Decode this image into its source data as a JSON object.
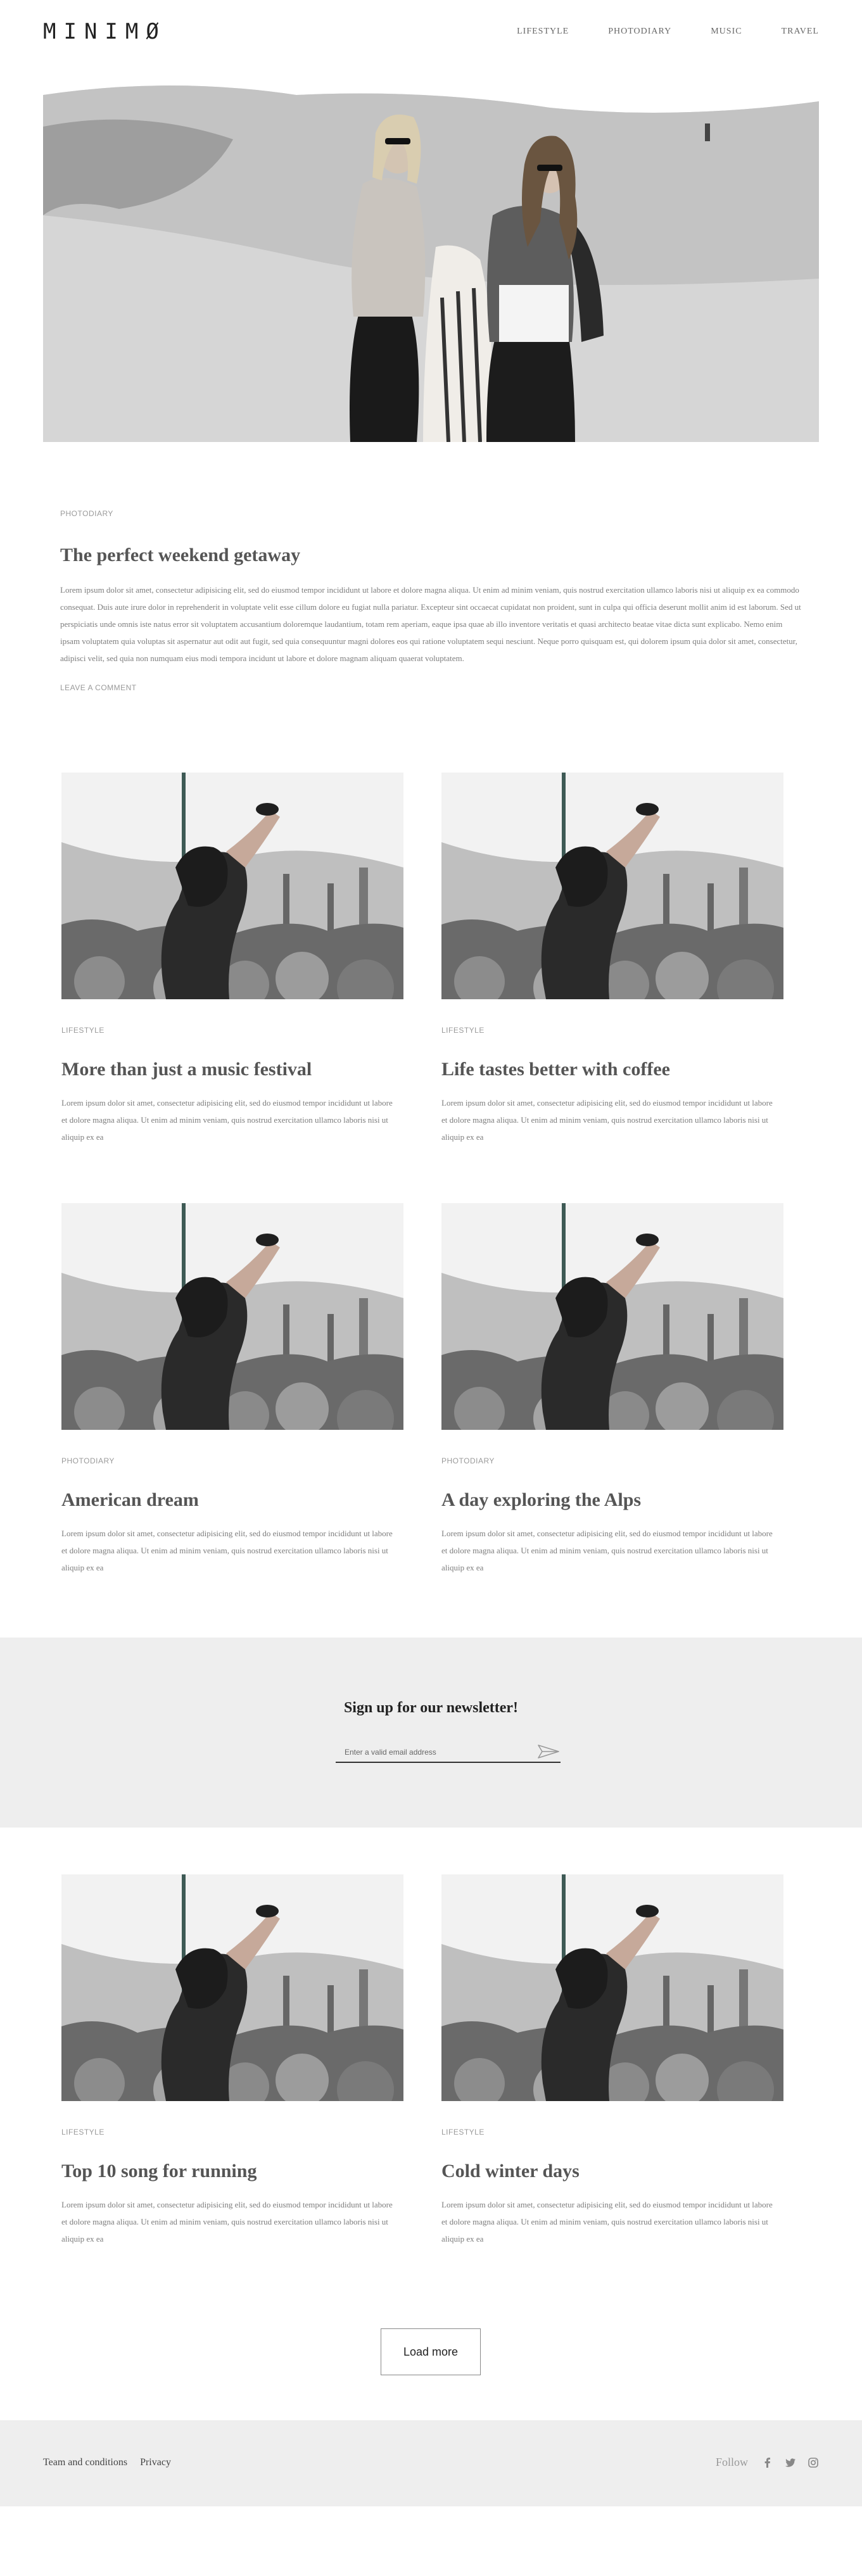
{
  "header": {
    "logo": "MINIMØ",
    "nav": [
      "LIFESTYLE",
      "PHOTODIARY",
      "MUSIC",
      "TRAVEL"
    ]
  },
  "featured": {
    "category": "PHOTODIARY",
    "title": "The perfect weekend getaway",
    "body": "Lorem ipsum dolor sit amet, consectetur adipisicing elit, sed do eiusmod tempor incididunt ut labore et dolore magna aliqua. Ut enim ad minim veniam, quis nostrud exercitation ullamco laboris nisi ut aliquip ex ea commodo consequat. Duis aute irure dolor in reprehenderit in voluptate velit esse cillum dolore eu fugiat nulla pariatur. Excepteur sint occaecat cupidatat non proident, sunt in culpa qui officia deserunt mollit anim id est laborum. Sed ut perspiciatis unde omnis iste natus error sit voluptatem accusantium doloremque laudantium, totam rem aperiam, eaque ipsa quae ab illo inventore veritatis et quasi architecto beatae vitae dicta sunt explicabo. Nemo enim ipsam voluptatem quia voluptas sit aspernatur aut odit aut fugit, sed quia consequuntur magni dolores eos qui ratione voluptatem sequi nesciunt. Neque porro quisquam est, qui dolorem ipsum quia dolor sit amet, consectetur, adipisci velit, sed quia non numquam eius modi tempora incidunt ut labore et dolore magnam aliquam quaerat voluptatem.",
    "comment_link": "LEAVE A COMMENT"
  },
  "posts": [
    {
      "category": "LIFESTYLE",
      "title": "More than just a music festival",
      "excerpt": "Lorem ipsum dolor sit amet, consectetur adipisicing elit, sed do eiusmod tempor incididunt ut labore et dolore magna aliqua. Ut enim ad minim veniam, quis nostrud exercitation ullamco laboris nisi ut aliquip ex ea"
    },
    {
      "category": "LIFESTYLE",
      "title": "Life tastes better with coffee",
      "excerpt": "Lorem ipsum dolor sit amet, consectetur adipisicing elit, sed do eiusmod tempor incididunt ut labore et dolore magna aliqua. Ut enim ad minim veniam, quis nostrud exercitation ullamco laboris nisi ut aliquip ex ea"
    },
    {
      "category": "PHOTODIARY",
      "title": "American dream",
      "excerpt": "Lorem ipsum dolor sit amet, consectetur adipisicing elit, sed do eiusmod tempor incididunt ut labore et dolore magna aliqua. Ut enim ad minim veniam, quis nostrud exercitation ullamco laboris nisi ut aliquip ex ea"
    },
    {
      "category": "PHOTODIARY",
      "title": "A day exploring the Alps",
      "excerpt": "Lorem ipsum dolor sit amet, consectetur adipisicing elit, sed do eiusmod tempor incididunt ut labore et dolore magna aliqua. Ut enim ad minim veniam, quis nostrud exercitation ullamco laboris nisi ut aliquip ex ea"
    },
    {
      "category": "LIFESTYLE",
      "title": "Top 10 song for running",
      "excerpt": "Lorem ipsum dolor sit amet, consectetur adipisicing elit, sed do eiusmod tempor incididunt ut labore et dolore magna aliqua. Ut enim ad minim veniam, quis nostrud exercitation ullamco laboris nisi ut aliquip ex ea"
    },
    {
      "category": "LIFESTYLE",
      "title": "Cold winter days",
      "excerpt": "Lorem ipsum dolor sit amet, consectetur adipisicing elit, sed do eiusmod tempor incididunt ut labore et dolore magna aliqua. Ut enim ad minim veniam, quis nostrud exercitation ullamco laboris nisi ut aliquip ex ea"
    }
  ],
  "newsletter": {
    "title": "Sign up for our newsletter!",
    "placeholder": "Enter a valid email address",
    "send_icon": "send-icon"
  },
  "load_more": "Load more",
  "footer": {
    "links": [
      "Team and conditions",
      "Privacy"
    ],
    "follow_label": "Follow",
    "social_icons": [
      "facebook-icon",
      "twitter-icon",
      "instagram-icon"
    ]
  },
  "colors": {
    "text": "#555555",
    "muted": "#9a9a9a",
    "band": "#eeeeee"
  }
}
